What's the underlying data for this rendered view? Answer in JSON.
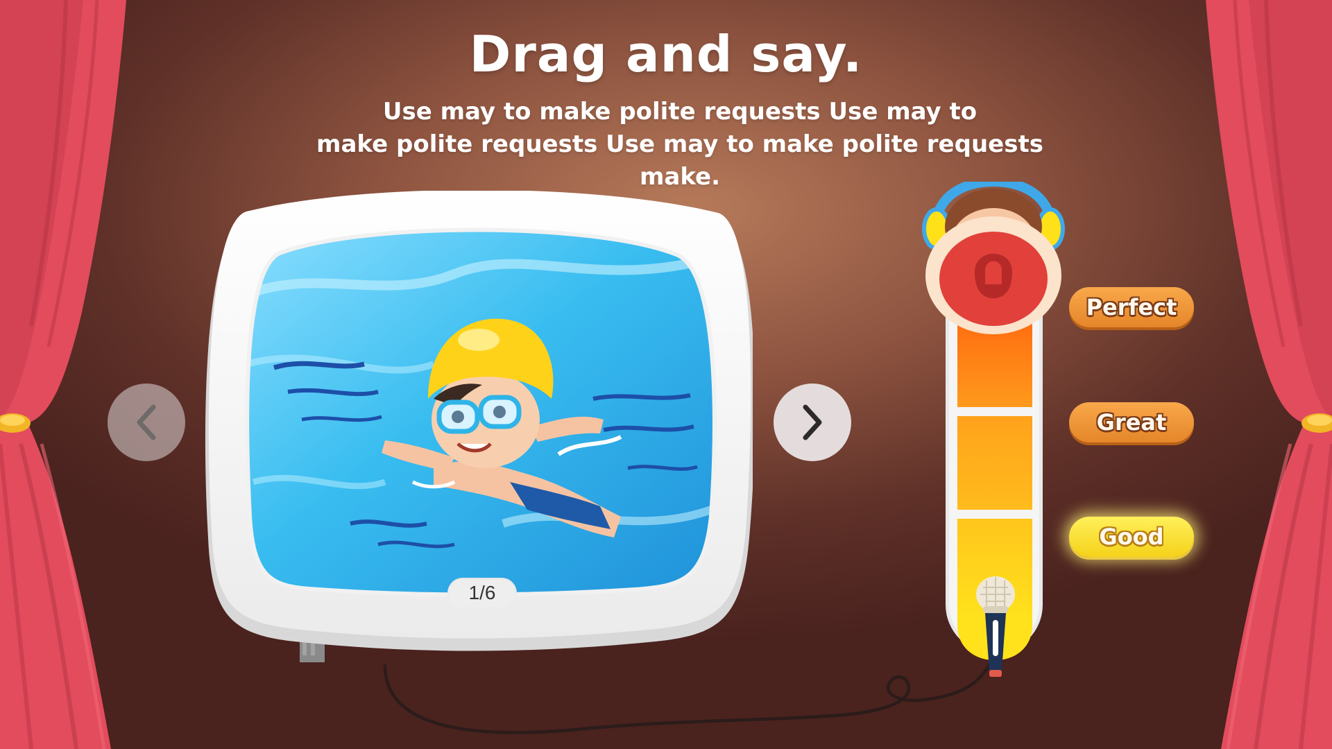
{
  "header": {
    "title": "Drag and say.",
    "subtitle_line1": "Use may to make polite requests Use may to",
    "subtitle_line2": "make polite requests Use may to make polite requests make."
  },
  "viewer": {
    "counter": "1/6",
    "current_page": 1,
    "total_pages": 6,
    "image_subject": "boy swimming in pool"
  },
  "navigation": {
    "prev_icon": "chevron-left-icon",
    "next_icon": "chevron-right-icon"
  },
  "score_meter": {
    "levels": [
      {
        "label": "Perfect",
        "active": false
      },
      {
        "label": "Great",
        "active": false
      },
      {
        "label": "Good",
        "active": true
      }
    ],
    "mascot": "monkey-headphones",
    "microphone_icon": "microphone-icon"
  },
  "colors": {
    "curtain": "#e5495a",
    "badge_orange": "#ef9838",
    "badge_yellow": "#f8e13a",
    "meter_orange": "#ff7a12",
    "meter_yellow": "#ffd21a"
  }
}
